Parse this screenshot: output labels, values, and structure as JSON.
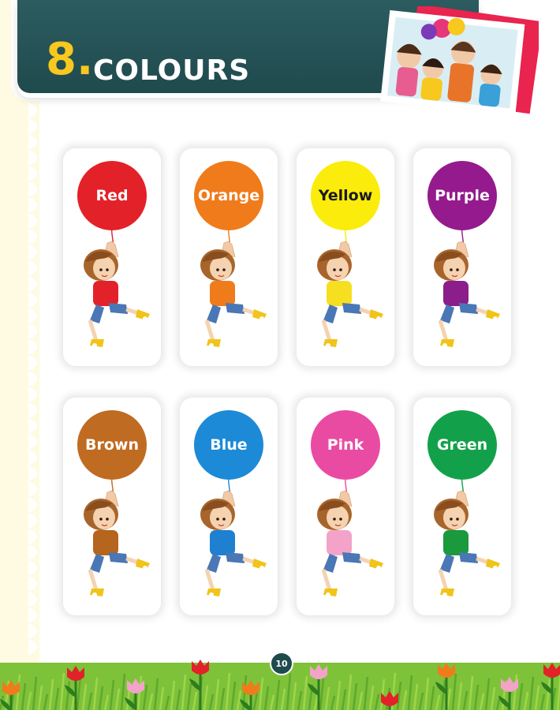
{
  "header": {
    "chapter_number": "8.",
    "title": "COLOURS"
  },
  "cards": [
    {
      "label": "Red",
      "color": "#e32129",
      "shirt": "#e32129",
      "dark_text": false
    },
    {
      "label": "Orange",
      "color": "#f07b1b",
      "shirt": "#f07b1b",
      "dark_text": false
    },
    {
      "label": "Yellow",
      "color": "#fbec0b",
      "shirt": "#f6df21",
      "dark_text": true
    },
    {
      "label": "Purple",
      "color": "#941a8e",
      "shirt": "#8b1e8b",
      "dark_text": false
    },
    {
      "label": "Brown",
      "color": "#c06b22",
      "shirt": "#b5651d",
      "dark_text": false
    },
    {
      "label": "Blue",
      "color": "#1c8ad6",
      "shirt": "#1f7fd1",
      "dark_text": false
    },
    {
      "label": "Pink",
      "color": "#ea4ba2",
      "shirt": "#f4a3c8",
      "dark_text": false
    },
    {
      "label": "Green",
      "color": "#12a14a",
      "shirt": "#1a9a3c",
      "dark_text": false
    }
  ],
  "footer": {
    "page_number": "10"
  }
}
